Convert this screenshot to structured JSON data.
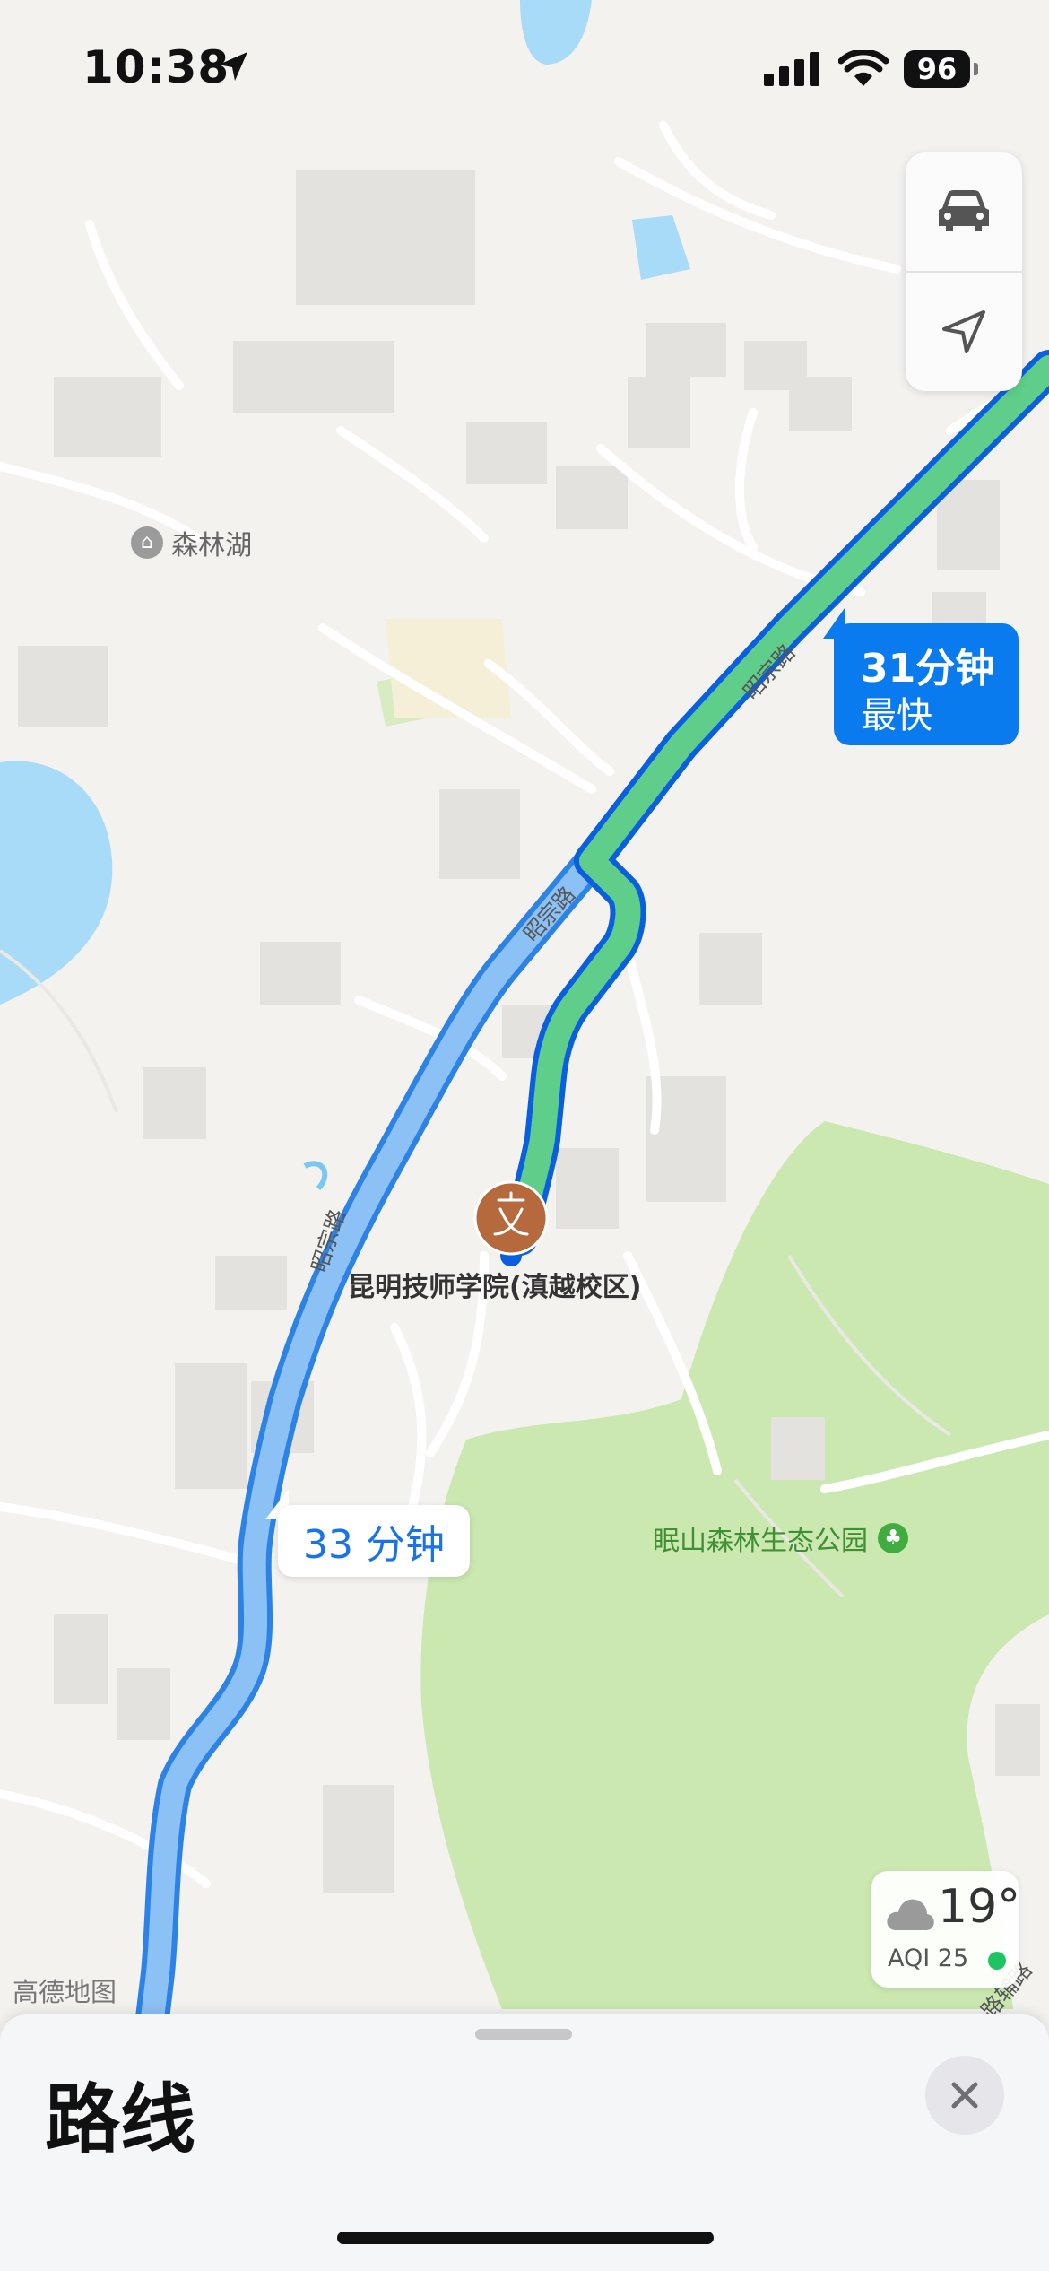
{
  "status_bar": {
    "time": "10:38",
    "battery": "96"
  },
  "map": {
    "places": {
      "lake_label": "森林湖",
      "school_label": "昆明技师学院(滇越校区)",
      "park_label": "眠山森林生态公园",
      "road_label": "昭宗路",
      "road_label_2": "路辅路"
    },
    "routes": [
      {
        "duration": "31分钟",
        "tag": "最快",
        "selected": true
      },
      {
        "duration": "33 分钟",
        "selected": false
      }
    ],
    "weather": {
      "temp": "19°",
      "aqi": "AQI 25"
    },
    "attribution": "高德地图",
    "colors": {
      "route_selected_fill": "#5fce8a",
      "route_selected_border": "#0a5ee0",
      "route_alt_fill": "#8cc1f5",
      "route_alt_border": "#2d82e6",
      "park": "#cbe8b0",
      "water": "#a7dbf7",
      "marker": "#b5693c"
    }
  },
  "controls": {
    "mode_icon": "car-icon",
    "locate_icon": "location-arrow-icon"
  },
  "sheet": {
    "title": "路线",
    "close_icon": "close-icon"
  }
}
